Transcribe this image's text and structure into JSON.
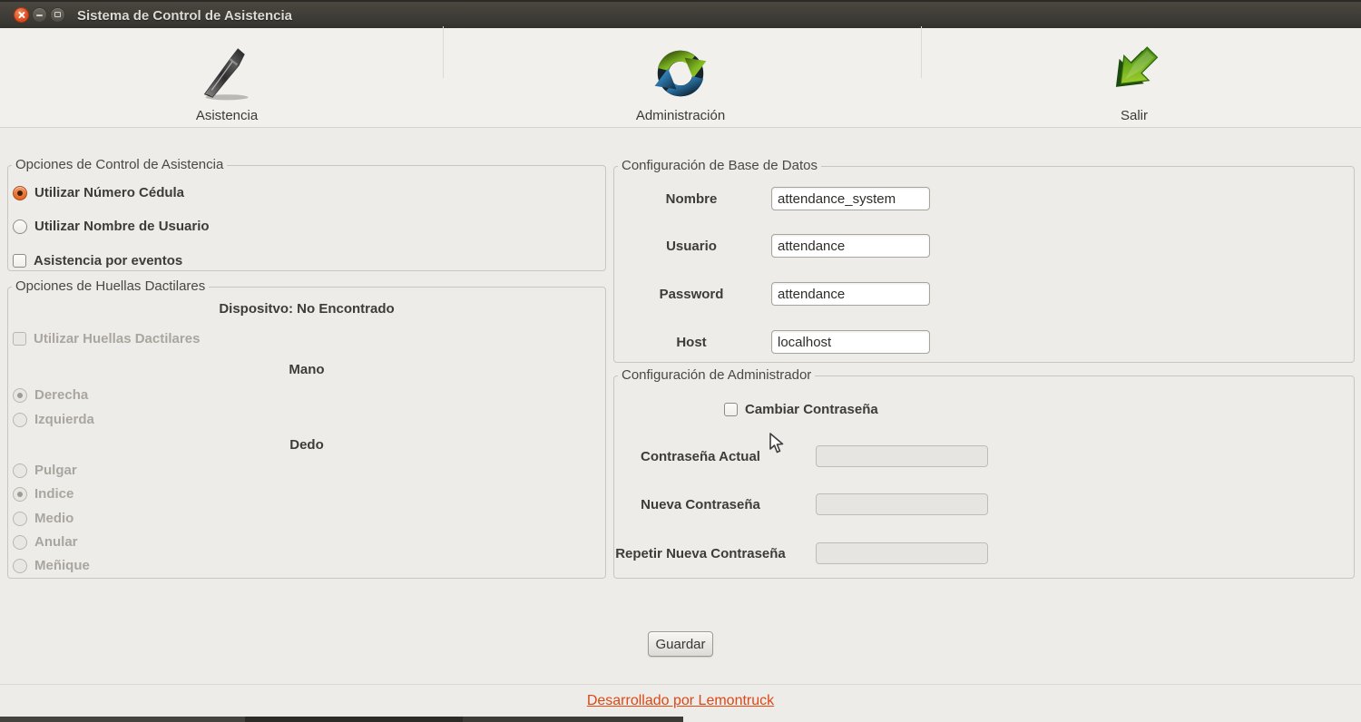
{
  "window": {
    "title": "Sistema de Control de Asistencia"
  },
  "toolbar": {
    "items": [
      {
        "id": "asistencia",
        "label": "Asistencia",
        "icon": "pen-icon"
      },
      {
        "id": "administracion",
        "label": "Administración",
        "icon": "sync-icon"
      },
      {
        "id": "salir",
        "label": "Salir",
        "icon": "green-arrow-icon"
      }
    ]
  },
  "attendance_options": {
    "title": "Opciones de Control de Asistencia",
    "use_id_number": {
      "label": "Utilizar Número Cédula",
      "type": "radio",
      "selected": true
    },
    "use_username": {
      "label": "Utilizar Nombre de Usuario",
      "type": "radio",
      "selected": false
    },
    "attendance_by_events": {
      "label": "Asistencia por eventos",
      "type": "checkbox",
      "checked": false
    }
  },
  "fingerprint_options": {
    "title": "Opciones de Huellas Dactilares",
    "device_status": "Dispositvo: No Encontrado",
    "use_fingerprints": {
      "label": "Utilizar Huellas Dactilares",
      "checked": false,
      "enabled": false
    },
    "hand": {
      "label": "Mano",
      "options": [
        {
          "label": "Derecha",
          "selected": true
        },
        {
          "label": "Izquierda",
          "selected": false
        }
      ]
    },
    "finger": {
      "label": "Dedo",
      "options": [
        {
          "label": "Pulgar",
          "selected": false
        },
        {
          "label": "Indice",
          "selected": true
        },
        {
          "label": "Medio",
          "selected": false
        },
        {
          "label": "Anular",
          "selected": false
        },
        {
          "label": "Meñique",
          "selected": false
        }
      ]
    }
  },
  "database_config": {
    "title": "Configuración de Base de Datos",
    "fields": [
      {
        "label": "Nombre",
        "value": "attendance_system"
      },
      {
        "label": "Usuario",
        "value": "attendance"
      },
      {
        "label": "Password",
        "value": "attendance"
      },
      {
        "label": "Host",
        "value": "localhost"
      }
    ]
  },
  "admin_config": {
    "title": "Configuración de Administrador",
    "change_password": {
      "label": "Cambiar Contraseña",
      "checked": false
    },
    "fields": [
      {
        "label": "Contraseña Actual",
        "value": "",
        "enabled": false
      },
      {
        "label": "Nueva Contraseña",
        "value": "",
        "enabled": false
      },
      {
        "label": "Repetir Nueva Contraseña",
        "value": "",
        "enabled": false
      }
    ]
  },
  "footer": {
    "save_button": "Guardar",
    "credit_link": "Desarrollado por Lemontruck"
  },
  "colors": {
    "accent_orange": "#dd4814",
    "radio_selected_fill": "#e4651f",
    "titlebar_background": "#3c3a35",
    "link": "#dd4814"
  }
}
